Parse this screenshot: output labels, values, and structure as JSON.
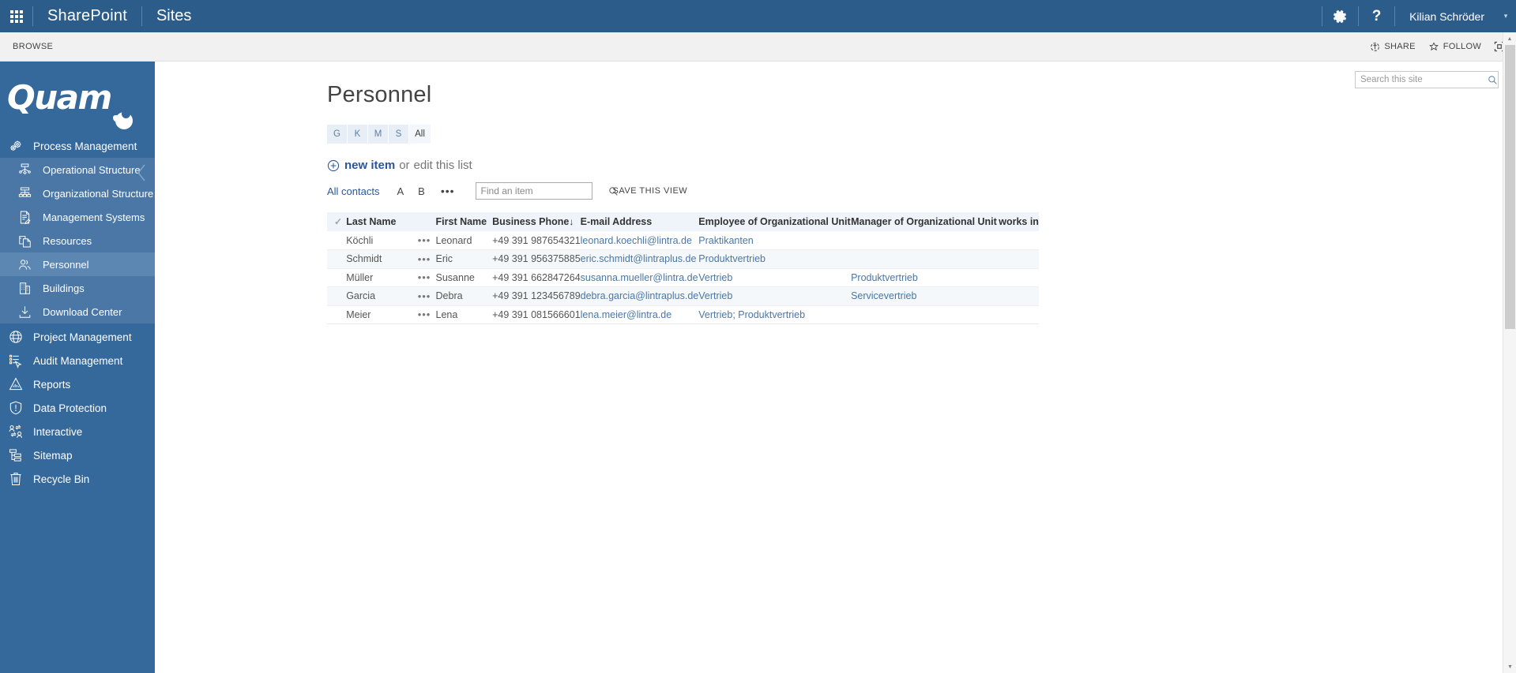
{
  "suitebar": {
    "app_launcher": "waffle-icon",
    "brand": "SharePoint",
    "sites_link": "Sites",
    "settings_icon": "gear-icon",
    "help_icon": "help-icon",
    "user_name": "Kilian Schröder",
    "user_caret": "▾",
    "bg_color": "#2b5c8a"
  },
  "ribbon": {
    "browse_tab": "BROWSE",
    "share_label": "SHARE",
    "follow_label": "FOLLOW",
    "focus_icon": "focus-on-content-icon"
  },
  "sidebar": {
    "logo_text": "Quam",
    "bg_color": "#35689b",
    "active_color": "#5c87b3",
    "subgroup_color": "#4a77a6",
    "collapse_icon": "chevron-left-icon",
    "items": [
      {
        "label": "Process Management",
        "icon": "gears-icon",
        "level": 0,
        "active": false
      },
      {
        "label": "Operational Structure",
        "icon": "flowchart-icon",
        "level": 1,
        "active": false
      },
      {
        "label": "Organizational Structure",
        "icon": "org-chart-icon",
        "level": 1,
        "active": false
      },
      {
        "label": "Management Systems",
        "icon": "document-edit-icon",
        "level": 1,
        "active": false
      },
      {
        "label": "Resources",
        "icon": "resources-icon",
        "level": 1,
        "active": false
      },
      {
        "label": "Personnel",
        "icon": "people-icon",
        "level": 1,
        "active": true
      },
      {
        "label": "Buildings",
        "icon": "building-icon",
        "level": 1,
        "active": false
      },
      {
        "label": "Download Center",
        "icon": "download-icon",
        "level": 1,
        "active": false
      },
      {
        "label": "Project Management",
        "icon": "globe-icon",
        "level": 0,
        "active": false
      },
      {
        "label": "Audit Management",
        "icon": "checklist-cursor-icon",
        "level": 0,
        "active": false
      },
      {
        "label": "Reports",
        "icon": "chart-report-icon",
        "level": 0,
        "active": false
      },
      {
        "label": "Data Protection",
        "icon": "shield-alert-icon",
        "level": 0,
        "active": false
      },
      {
        "label": "Interactive",
        "icon": "people-exchange-icon",
        "level": 0,
        "active": false
      },
      {
        "label": "Sitemap",
        "icon": "sitemap-icon",
        "level": 0,
        "active": false
      },
      {
        "label": "Recycle Bin",
        "icon": "trash-icon",
        "level": 0,
        "active": false
      }
    ]
  },
  "site_search": {
    "placeholder": "Search this site",
    "value": "",
    "icon": "search-icon"
  },
  "main": {
    "page_title": "Personnel",
    "filter_pills": [
      {
        "label": "G",
        "selected": false
      },
      {
        "label": "K",
        "selected": false
      },
      {
        "label": "M",
        "selected": false
      },
      {
        "label": "S",
        "selected": false
      },
      {
        "label": "All",
        "selected": true
      }
    ],
    "new_item": {
      "plus_icon": "plus-circle-icon",
      "link": "new item",
      "or": "or",
      "edit": "edit this list"
    },
    "view_toolbar": {
      "current_view": "All contacts",
      "letters": [
        "A",
        "B"
      ],
      "ellipsis": "•••",
      "find_placeholder": "Find an item",
      "find_value": "",
      "find_icon": "search-icon",
      "save_view": "SAVE THIS VIEW"
    }
  },
  "table": {
    "select_all_icon": "checkmark-icon",
    "columns": [
      "Last Name",
      "First Name",
      "Business Phone",
      "E-mail Address",
      "Employee of Organizational Unit",
      "Manager of Organizational Unit",
      "works in"
    ],
    "sorted_column": "Business Phone",
    "sort_arrow": "↓",
    "rows": [
      {
        "last_name": "Köchli",
        "dots": "•••",
        "first_name": "Leonard",
        "phone": "+49 391 987654321",
        "email": "leonard.koechli@lintra.de",
        "employee_of": "Praktikanten",
        "manager_of": "",
        "works_in": ""
      },
      {
        "last_name": "Schmidt",
        "dots": "•••",
        "first_name": "Eric",
        "phone": "+49 391 956375885",
        "email": "eric.schmidt@lintraplus.de",
        "employee_of": "Produktvertrieb",
        "manager_of": "",
        "works_in": ""
      },
      {
        "last_name": "Müller",
        "dots": "•••",
        "first_name": "Susanne",
        "phone": "+49 391 662847264",
        "email": "susanna.mueller@lintra.de",
        "employee_of": "Vertrieb",
        "manager_of": "Produktvertrieb",
        "works_in": ""
      },
      {
        "last_name": "Garcia",
        "dots": "•••",
        "first_name": "Debra",
        "phone": "+49 391 123456789",
        "email": "debra.garcia@lintraplus.de",
        "employee_of": "Vertrieb",
        "manager_of": "Servicevertrieb",
        "works_in": ""
      },
      {
        "last_name": "Meier",
        "dots": "•••",
        "first_name": "Lena",
        "phone": "+49 391 081566601",
        "email": "lena.meier@lintra.de",
        "employee_of": "Vertrieb; Produktvertrieb",
        "manager_of": "",
        "works_in": ""
      }
    ]
  },
  "scrollbar": {
    "up_arrow": "▲",
    "down_arrow": "▼"
  }
}
